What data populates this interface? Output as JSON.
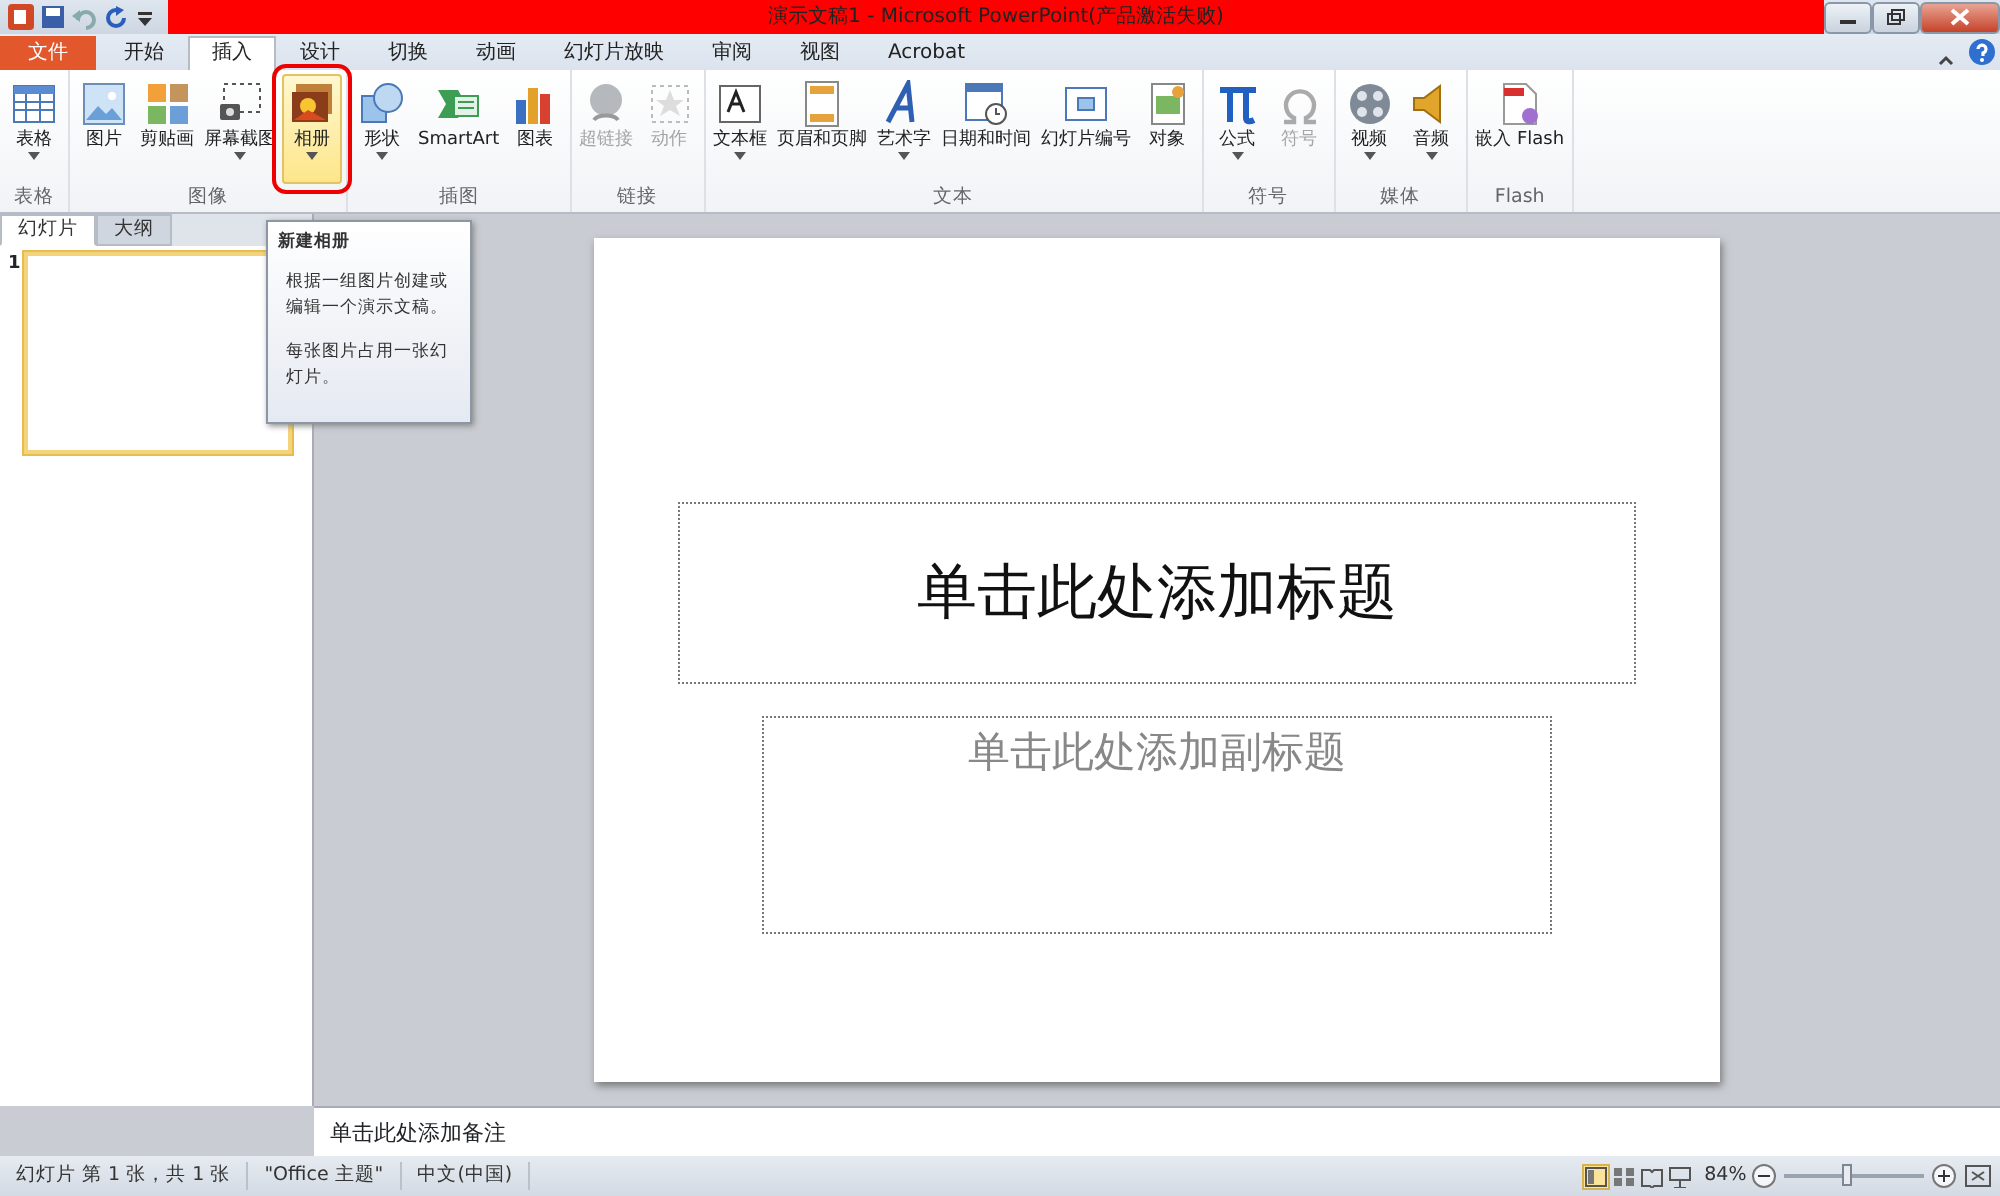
{
  "window": {
    "title": "演示文稿1 - Microsoft PowerPoint(产品激活失败)"
  },
  "tabs": [
    {
      "label": "文件",
      "kind": "file",
      "selected": false
    },
    {
      "label": "开始",
      "kind": "tab",
      "selected": false
    },
    {
      "label": "插入",
      "kind": "tab",
      "selected": true
    },
    {
      "label": "设计",
      "kind": "tab",
      "selected": false
    },
    {
      "label": "切换",
      "kind": "tab",
      "selected": false
    },
    {
      "label": "动画",
      "kind": "tab",
      "selected": false
    },
    {
      "label": "幻灯片放映",
      "kind": "tab",
      "selected": false
    },
    {
      "label": "审阅",
      "kind": "tab",
      "selected": false
    },
    {
      "label": "视图",
      "kind": "tab",
      "selected": false
    },
    {
      "label": "Acrobat",
      "kind": "tab",
      "selected": false
    }
  ],
  "ribbon": {
    "groups": [
      {
        "label": "表格",
        "buttons": [
          {
            "label": "表格",
            "dropdown": true,
            "disabled": false,
            "highlighted": false
          }
        ]
      },
      {
        "label": "图像",
        "buttons": [
          {
            "label": "图片",
            "dropdown": false,
            "disabled": false,
            "highlighted": false
          },
          {
            "label": "剪贴画",
            "dropdown": false,
            "disabled": false,
            "highlighted": false
          },
          {
            "label": "屏幕截图",
            "dropdown": true,
            "disabled": false,
            "highlighted": false
          },
          {
            "label": "相册",
            "dropdown": true,
            "disabled": false,
            "highlighted": true
          }
        ]
      },
      {
        "label": "插图",
        "buttons": [
          {
            "label": "形状",
            "dropdown": true,
            "disabled": false,
            "highlighted": false
          },
          {
            "label": "SmartArt",
            "dropdown": false,
            "disabled": false,
            "highlighted": false
          },
          {
            "label": "图表",
            "dropdown": false,
            "disabled": false,
            "highlighted": false
          }
        ]
      },
      {
        "label": "链接",
        "buttons": [
          {
            "label": "超链接",
            "dropdown": false,
            "disabled": true,
            "highlighted": false
          },
          {
            "label": "动作",
            "dropdown": false,
            "disabled": true,
            "highlighted": false
          }
        ]
      },
      {
        "label": "文本",
        "buttons": [
          {
            "label": "文本框",
            "dropdown": true,
            "disabled": false,
            "highlighted": false
          },
          {
            "label": "页眉和页脚",
            "dropdown": false,
            "disabled": false,
            "highlighted": false
          },
          {
            "label": "艺术字",
            "dropdown": true,
            "disabled": false,
            "highlighted": false
          },
          {
            "label": "日期和时间",
            "dropdown": false,
            "disabled": false,
            "highlighted": false
          },
          {
            "label": "幻灯片编号",
            "dropdown": false,
            "disabled": false,
            "highlighted": false
          },
          {
            "label": "对象",
            "dropdown": false,
            "disabled": false,
            "highlighted": false
          }
        ]
      },
      {
        "label": "符号",
        "buttons": [
          {
            "label": "公式",
            "dropdown": true,
            "disabled": false,
            "highlighted": false
          },
          {
            "label": "符号",
            "dropdown": false,
            "disabled": true,
            "highlighted": false
          }
        ]
      },
      {
        "label": "媒体",
        "buttons": [
          {
            "label": "视频",
            "dropdown": true,
            "disabled": false,
            "highlighted": false
          },
          {
            "label": "音频",
            "dropdown": true,
            "disabled": false,
            "highlighted": false
          }
        ]
      },
      {
        "label": "Flash",
        "buttons": [
          {
            "label": "嵌入 Flash",
            "dropdown": false,
            "disabled": false,
            "highlighted": false
          }
        ]
      }
    ]
  },
  "tooltip": {
    "title": "新建相册",
    "paragraphs": [
      "根据一组图片创建或编辑一个演示文稿。",
      "每张图片占用一张幻灯片。"
    ]
  },
  "pane_tabs": [
    {
      "label": "幻灯片",
      "selected": true
    },
    {
      "label": "大纲",
      "selected": false
    }
  ],
  "thumbnails": [
    {
      "number": "1",
      "selected": true
    }
  ],
  "slide": {
    "title_placeholder": "单击此处添加标题",
    "subtitle_placeholder": "单击此处添加副标题"
  },
  "notes": {
    "placeholder": "单击此处添加备注"
  },
  "status_bar": {
    "items": [
      "幻灯片 第 1 张，共 1 张",
      "\"Office 主题\"",
      "中文(中国)"
    ],
    "views": [
      {
        "selected": true
      },
      {
        "selected": false
      },
      {
        "selected": false
      },
      {
        "selected": false
      }
    ],
    "zoom": "84%",
    "zoom_slider": {
      "level": 0.46
    }
  }
}
